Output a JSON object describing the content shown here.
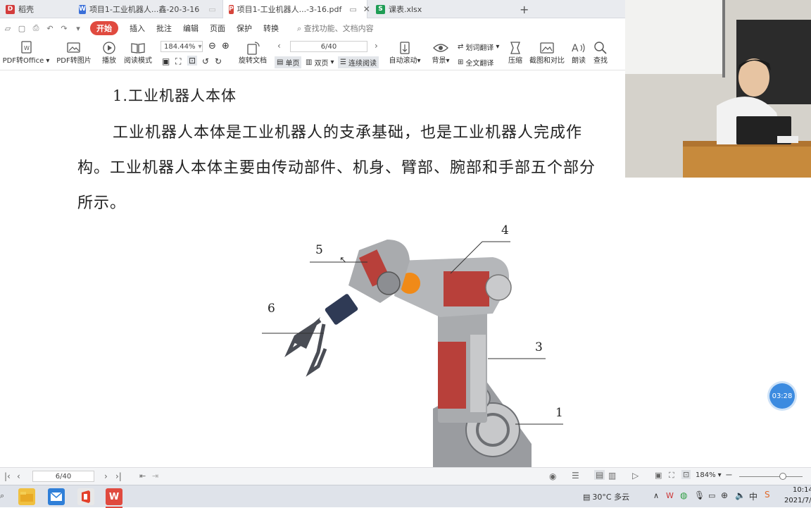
{
  "tabs": [
    {
      "label": "稻壳",
      "icon": "daoke-icon",
      "color": "#d33c3c",
      "active": false
    },
    {
      "label": "项目1-工业机器人...鑫-20-3-16",
      "icon": "word-doc-icon",
      "color": "#3a6fd8",
      "active": false
    },
    {
      "label": "项目1-工业机器人...-3-16.pdf",
      "icon": "pdf-icon",
      "color": "#d6453b",
      "active": true
    },
    {
      "label": "课表.xlsx",
      "icon": "excel-icon",
      "color": "#1f9d55",
      "active": false
    }
  ],
  "menu": {
    "start": "开始",
    "items": [
      "插入",
      "批注",
      "编辑",
      "页面",
      "保护",
      "转换"
    ],
    "search_placeholder": "查找功能、文档内容"
  },
  "ribbon": {
    "pdf_to_office": "PDF转Office",
    "pdf_to_image": "PDF转图片",
    "play": "播放",
    "read_mode": "阅读模式",
    "zoom": "184.44%",
    "rotate": "旋转文档",
    "page_box": "6/40",
    "single_page": "单页",
    "double_page": "双页",
    "continuous": "连续阅读",
    "auto_scroll": "自动滚动",
    "background": "背景",
    "word_translate": "划词翻译",
    "full_translate": "全文翻译",
    "compress": "压缩",
    "screenshot_compare": "截图和对比",
    "read_aloud": "朗读",
    "find": "查找"
  },
  "document": {
    "heading": "1.工业机器人本体",
    "line1": "工业机器人本体是工业机器人的支承基础，也是工业机器人完成作",
    "line2": "构。工业机器人本体主要由传动部件、机身、臂部、腕部和手部五个部分",
    "line3": "所示。",
    "labels": [
      "1",
      "3",
      "4",
      "5",
      "6"
    ]
  },
  "timer": "03:28",
  "statusbar": {
    "page": "6/40",
    "zoom": "184%"
  },
  "taskbar": {
    "weather": "30°C 多云",
    "ime": "中",
    "time": "10:14",
    "date": "2021/7/"
  },
  "colors": {
    "accent": "#e04a3f",
    "robot_red": "#b8403a",
    "robot_gray": "#9a9ca0",
    "timer": "#3c8be0"
  }
}
